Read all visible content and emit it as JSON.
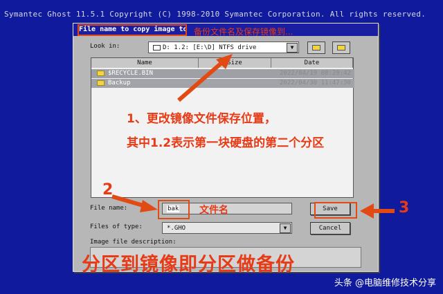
{
  "app_title": "Symantec Ghost 11.5.1   Copyright (C) 1998-2010 Symantec Corporation. All rights reserved.",
  "dialog": {
    "title": "File name to copy image to",
    "look_in_label": "Look in:",
    "look_in_value": "D: 1.2: [E:\\D] NTFS drive",
    "columns": [
      "Name",
      "Size",
      "Date"
    ],
    "files": [
      {
        "name": "$RECYCLE.BIN",
        "date": "2022/04/19 08:29:42"
      },
      {
        "name": "Backup",
        "date": "2022/04/30 11:47:30"
      }
    ],
    "file_name_label": "File name:",
    "file_name_value": "bak",
    "files_of_type_label": "Files of type:",
    "files_of_type_value": "*.GHO",
    "image_desc_label": "Image file description:",
    "save_label": "Save",
    "cancel_label": "Cancel"
  },
  "annotations": {
    "title_note": "备份文件名及保存镜像到...",
    "step1_line1": "1、更改镜像文件保存位置，",
    "step1_line2": "其中1.2表示第一块硬盘的第二个分区",
    "step2_num": "2",
    "filename_note": "文件名",
    "step3_num": "3",
    "bottom_caption": "分区到镜像即分区做备份",
    "watermark": "头条 @电脑维修技术分享"
  },
  "colors": {
    "background": "#0f1a9c",
    "annotation": "#e63b16",
    "dialog": "#b7b7b7"
  }
}
